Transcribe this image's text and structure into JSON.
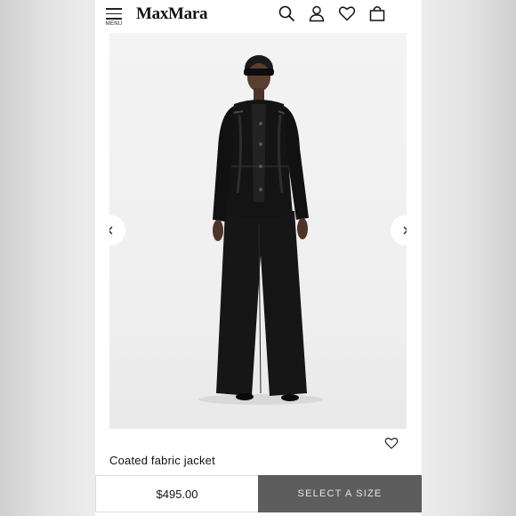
{
  "header": {
    "logo": "MaxMara",
    "menu_label": "MENU",
    "icons": [
      "search-icon",
      "account-icon",
      "wishlist-icon",
      "shopping-bag-icon"
    ]
  },
  "gallery": {
    "prev_icon": "chevron-left-icon",
    "next_icon": "chevron-right-icon"
  },
  "product": {
    "name": "Coated fabric jacket",
    "price": "$495.00",
    "wishlist_icon": "heart-outline-icon"
  },
  "actions": {
    "select_size_label": "SELECT A SIZE"
  },
  "colors": {
    "button_bg": "#5d5d5d",
    "button_text": "#e6e6e6",
    "page_bg": "#ffffff"
  }
}
